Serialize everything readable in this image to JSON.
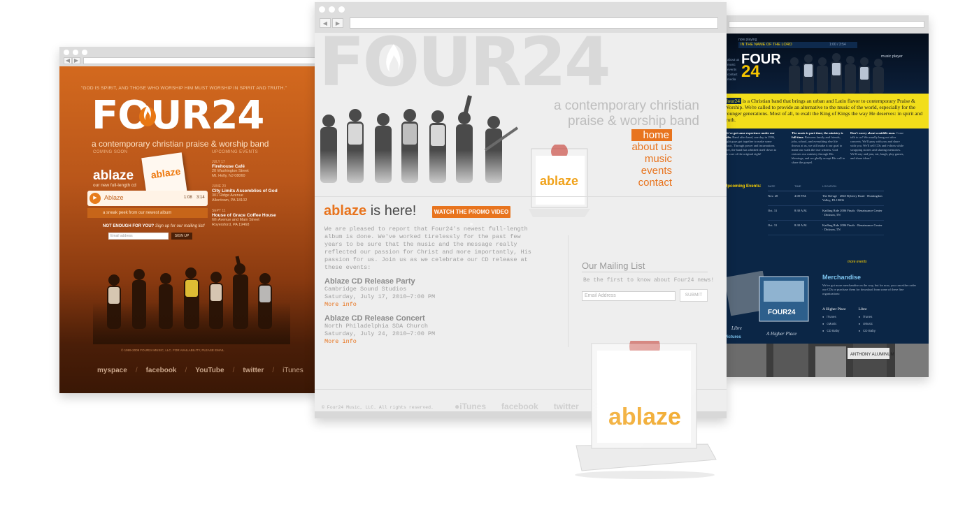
{
  "left_site": {
    "quote": "\"GOD IS SPIRIT, AND THOSE WHO WORSHIP HIM MUST WORSHIP IN SPIRIT AND TRUTH.\"",
    "logo": "FOUR24",
    "tagline": "a contemporary christian praise & worship band",
    "coming_soon_label": "COMING SOON",
    "upcoming_label": "UPCOMING EVENTS",
    "album_title": "ablaze",
    "album_subtitle": "our new full-length cd",
    "cd_art_text": "ablaze",
    "player": {
      "track": "Ablaze",
      "elapsed": "1:08",
      "duration": "3:14",
      "subtitle": "a sneak peek from our newest album"
    },
    "events": [
      {
        "date": "JULY 17",
        "name": "Firehouse Café",
        "addr1": "20 Washington Street",
        "addr2": "Mt. Holly, NJ 08060"
      },
      {
        "date": "JUNE 20",
        "name": "City Limits Assemblies of God",
        "addr1": "301 Ridge Avenue",
        "addr2": "Allentown, PA 18102"
      },
      {
        "date": "SEPT 11",
        "name": "House of Grace Coffee House",
        "addr1": "6th Avenue and Main Street",
        "addr2": "Royersford, PA 19468"
      }
    ],
    "signup_question": "NOT ENOUGH FOR YOU?",
    "signup_prompt": "Sign up for our mailing list!",
    "email_placeholder": "Email address",
    "signup_button": "SIGN UP",
    "copyright": "© 1999-2009 FOUR24 MUSIC, LLC. FOR AVAILABILITY, PLEASE EMAIL",
    "social": [
      "myspace",
      "facebook",
      "YouTube",
      "twitter",
      "iTunes"
    ]
  },
  "middle_site": {
    "logo": "FOUR24",
    "subtitle_line1": "a contemporary christian",
    "subtitle_line2": "praise & worship band",
    "nav": [
      "home",
      "about us",
      "music",
      "events",
      "contact"
    ],
    "active_nav": "home",
    "headline_brand": "ablaze",
    "headline_rest": " is here!",
    "promo_button": "WATCH THE PROMO VIDEO »",
    "body": "We are pleased to report that Four24's newest full-length album is done. We've worked tirelessly for the past few years to be sure that the music and the message really reflected our passion for Christ and more importantly, His passion for us. Join us as we celebrate our CD release at these events:",
    "events": [
      {
        "title": "Ablaze CD Release Party",
        "venue": "Cambridge Sound Studios",
        "when": "Saturday, July 17, 2010—7:00 PM",
        "more": "More info"
      },
      {
        "title": "Ablaze CD Release Concert",
        "venue": "North Philadelphia SDA Church",
        "when": "Saturday, July 24, 2010—7:00 PM",
        "more": "More info"
      }
    ],
    "mailing_heading": "Our Mailing List",
    "mailing_sub": "Be the first to know about Four24 news!",
    "email_placeholder": "Email Address",
    "submit_button": "SUBMIT",
    "copyright": "© Four24 Music, LLC. All rights reserved.",
    "social": [
      "iTunes",
      "facebook",
      "twitter"
    ],
    "cd_art_text": "ablaze"
  },
  "right_site": {
    "now_playing_label": "now playing",
    "song": "IN THE NAME OF THE LORD",
    "time": "1:00 / 3:54",
    "logo_top": "FOUR",
    "logo_bottom": "24",
    "music_player_label": "music player",
    "menu": [
      "about us",
      "music",
      "events",
      "contact",
      "media"
    ],
    "intro_highlight": "four24",
    "intro_text": " is a Christian band that brings an urban and Latin flavor to contemporary Praise & Worship. We're called to provide an alternative to the music of the world, especially for the younger generations. Most of all, to exalt the King of Kings the way He deserves: in spirit and truth.",
    "columns": [
      {
        "lead": "We've got some experience under our belts.",
        "text": "Band after band, one day in 1996, eight guys got together to make some music. Through power and incarnations later, the band has whittled itself down to the core of the original eight!"
      },
      {
        "lead": "The music is part-time; the ministry is full-time.",
        "text": "Between family and friends, jobs, school, and everything else life throws at us, we still make it our goal to make our walk the true witness. God restores our ministry through His blessings, and we gladly accept His call to share the gospel."
      },
      {
        "lead": "Don't worry about a middle man.",
        "text": "Come talk to us! We usually hang out after concerts. We'll pray with you and share with you. We'll sell CDs and t-shirts while swapping stories and sharing memories. We'll stay and jam, eat, laugh, play games, and share ideas!"
      }
    ],
    "events_heading": "Upcoming Events:",
    "table_headers": [
      "DATE",
      "TIME",
      "LOCATION"
    ],
    "events": [
      {
        "date": "Nov. 28",
        "time": "4:00 P.M.",
        "location": "The Refuge · 2845 Byberry Road · Huntingdon Valley, PA 19006"
      },
      {
        "date": "Oct. 31",
        "time": "8:30 A.M.",
        "location": "Kadling Ride 2006 Finals · Renaissance Center · Dickson, TN"
      },
      {
        "date": "Oct. 31",
        "time": "8:30 A.M.",
        "location": "Kadling Ride 2006 Finals · Renaissance Center · Dickson, TN"
      }
    ],
    "more_events": "more events",
    "merch_heading": "Merchandise",
    "merch_text": "We've got more merchandise on the way, but for now, you can either order our CDs or purchase them for download from some of these fine organizations:",
    "albums": [
      {
        "title": "A Higher Place",
        "links": [
          "iTunes",
          "cMusic",
          "CD Baby"
        ]
      },
      {
        "title": "Libre",
        "links": [
          "iTunes",
          "cMusic",
          "CD Baby"
        ]
      }
    ],
    "caption_libre": "Libre",
    "caption_higher": "A Higher Place",
    "pictures_heading": "Pictures",
    "photo_sign": "ANTHONY ALUMINUM"
  }
}
